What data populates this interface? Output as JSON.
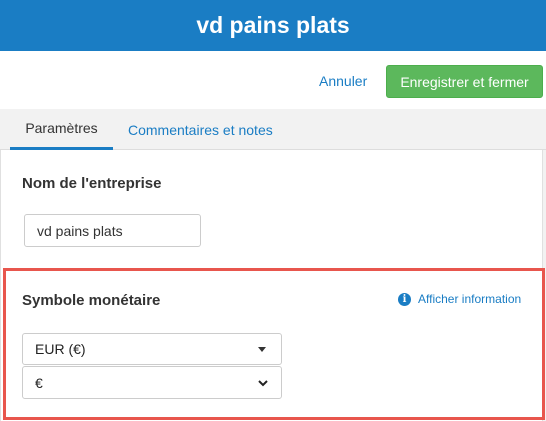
{
  "header": {
    "title": "vd pains plats"
  },
  "actions": {
    "cancel_label": "Annuler",
    "save_label": "Enregistrer et fermer"
  },
  "tabs": [
    {
      "label": "Paramètres",
      "active": true
    },
    {
      "label": "Commentaires et notes",
      "active": false
    }
  ],
  "company": {
    "title": "Nom de l'entreprise",
    "name_value": "vd pains plats"
  },
  "currency": {
    "title": "Symbole monétaire",
    "info_label": "Afficher information",
    "currency_selected": "EUR (€)",
    "symbol_selected": "€"
  },
  "colors": {
    "header": "#1a7dc4",
    "save_button": "#5cb85c",
    "highlight_border": "#e8564d",
    "link": "#1a7dc4"
  }
}
